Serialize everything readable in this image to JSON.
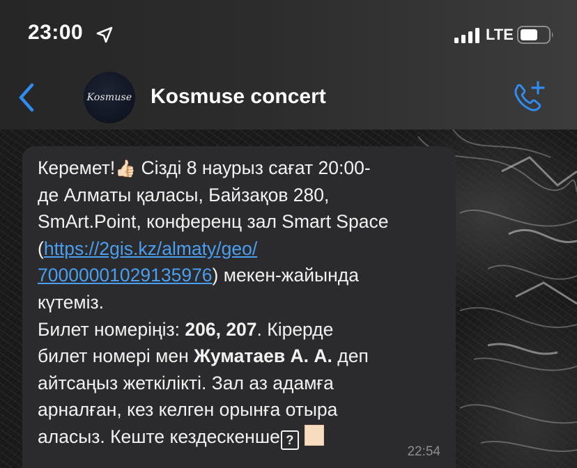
{
  "status_bar": {
    "time": "23:00",
    "network": "LTE",
    "location_icon": "location-arrow-icon",
    "signal_icon": "cellular-signal-icon",
    "battery_icon": "battery-icon"
  },
  "nav": {
    "back_icon": "chevron-left-icon",
    "avatar_text": "Kosmuse",
    "title": "Kosmuse concert",
    "action_icon": "add-call-icon",
    "accent_color": "#2f8cf0"
  },
  "message": {
    "lines": [
      {
        "t1": "Керемет!",
        "t2": " Сізді 8 наурыз сағат 20:00-"
      },
      {
        "t": "де Алматы қаласы, Байзақов 280,"
      },
      {
        "t": "SmArt.Point, конференц зал Smart Space"
      },
      {
        "pre": "(",
        "link": "https://2gis.kz/almaty/geo/"
      },
      {
        "link": "70000001029135976",
        "post": ") мекен-жайында"
      },
      {
        "t": "күтеміз."
      },
      {
        "pre": "Билет номеріңіз: ",
        "bold": "206, 207",
        "post": ". Кірерде"
      },
      {
        "pre": "билет номері мен ",
        "bold": "Жуматаев А. А.",
        "post": " деп"
      },
      {
        "t": "айтсаңыз жеткілікті. Зал аз адамға"
      },
      {
        "t": "арналған, кез келген орынға отыра"
      },
      {
        "t": "аласыз. Кеште кездескенше"
      }
    ],
    "emoji_icon": "thumbs-up-icon",
    "missing_glyph": "?",
    "time": "22:54",
    "link_color": "#4a9ff0",
    "bubble_color": "#2b2b2d"
  }
}
